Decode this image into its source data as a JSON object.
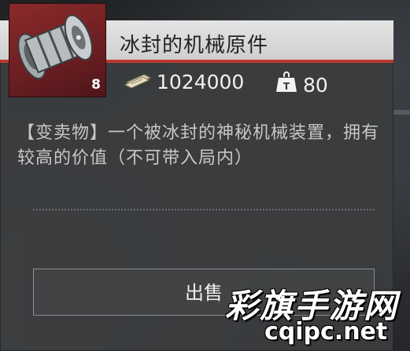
{
  "item": {
    "name": "冰封的机械原件",
    "quantity": "8",
    "icon": "frozen-mechanical-part-icon",
    "price": "1024000",
    "price_icon": "cash-stack-icon",
    "weight": "80",
    "weight_icon": "weight-icon",
    "description": "【变卖物】一个被冰封的神秘机械装置，拥有较高的价值（不可带入局内）"
  },
  "actions": {
    "sell_label": "出售"
  },
  "watermark": {
    "line1": "彩旗手游网",
    "line2": "cqipc.net"
  },
  "colors": {
    "accent_red": "#c0392f",
    "icon_bg": "#7a2326",
    "panel_bg": "#3a3c3e"
  }
}
